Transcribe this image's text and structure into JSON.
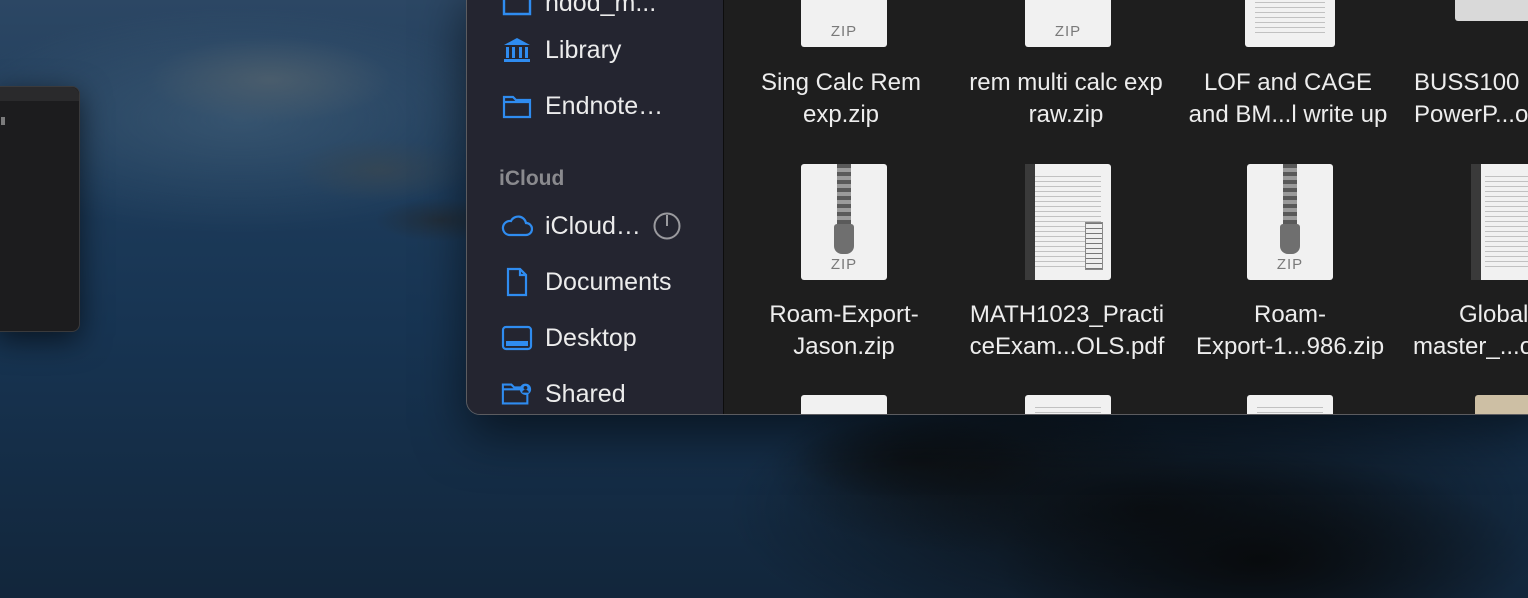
{
  "sidebar": {
    "items_top": [
      {
        "label": "Library",
        "icon": "building-columns-icon"
      },
      {
        "label": "Endnote…",
        "icon": "folder-icon"
      }
    ],
    "cut_off_item": {
      "label": "ndod_m...",
      "icon": "folder-icon"
    },
    "section_icloud": "iCloud",
    "items_icloud": [
      {
        "label": "iCloud…",
        "icon": "cloud-icon",
        "status": "syncing"
      },
      {
        "label": "Documents",
        "icon": "document-icon"
      },
      {
        "label": "Desktop",
        "icon": "desktop-icon"
      },
      {
        "label": "Shared",
        "icon": "shared-folder-icon"
      }
    ]
  },
  "files": {
    "row1": [
      {
        "name_l1": "Sing Calc Rem",
        "name_l2": "exp.zip",
        "type": "zip"
      },
      {
        "name_l1": "rem multi calc exp",
        "name_l2": "raw.zip",
        "type": "zip"
      },
      {
        "name_l1": "LOF and CAGE",
        "name_l2": "and BM...l write up",
        "type": "pdf"
      },
      {
        "name_l1": "BUSS100",
        "name_l2": "PowerP...o",
        "type": "ppt"
      }
    ],
    "row2": [
      {
        "name_l1": "Roam-Export-",
        "name_l2": "Jason.zip",
        "type": "zip"
      },
      {
        "name_l1": "MATH1023_Practi",
        "name_l2": "ceExam...OLS.pdf",
        "type": "pdf"
      },
      {
        "name_l1": "Roam-",
        "name_l2": "Export-1...986.zip",
        "type": "zip"
      },
      {
        "name_l1": "Global",
        "name_l2": "master_...o",
        "type": "doc"
      }
    ],
    "zip_badge": "ZIP"
  },
  "colors": {
    "sidebar_icon": "#2f8cf0",
    "sidebar_bg": "#242530",
    "content_bg": "#1e1e1e"
  }
}
